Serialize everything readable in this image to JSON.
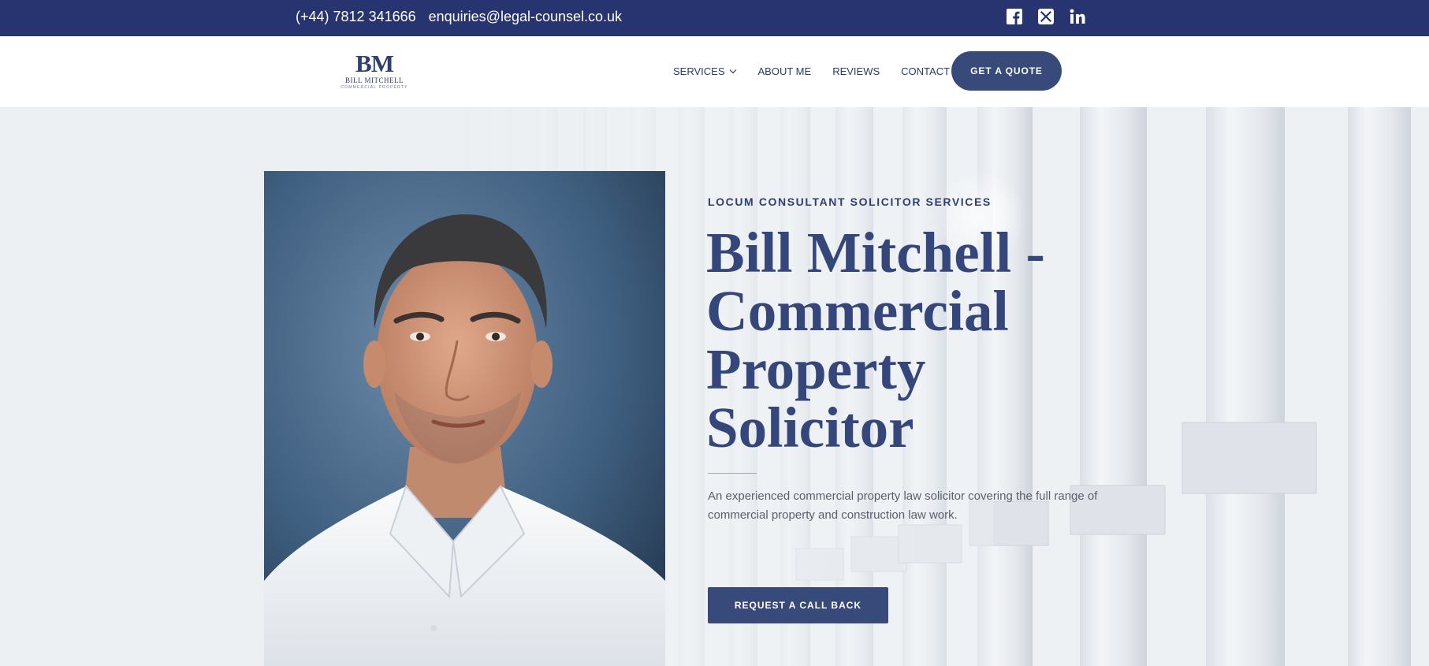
{
  "topbar": {
    "phone": "(+44) 7812 341666",
    "email": "enquiries@legal-counsel.co.uk",
    "socials": [
      "facebook-icon",
      "x-twitter-icon",
      "linkedin-icon"
    ],
    "bg_color": "#283470"
  },
  "logo": {
    "monogram": "BM",
    "name": "BILL MITCHELL",
    "tagline": "COMMERCIAL PROPERTY"
  },
  "nav": {
    "items": [
      {
        "label": "SERVICES",
        "has_dropdown": true
      },
      {
        "label": "ABOUT ME"
      },
      {
        "label": "REVIEWS"
      },
      {
        "label": "CONTACT"
      }
    ],
    "cta_label": "GET A QUOTE"
  },
  "hero": {
    "eyebrow": "LOCUM CONSULTANT SOLICITOR SERVICES",
    "title": "Bill Mitchell - Commercial Property Solicitor",
    "description": "An experienced commercial property law solicitor covering the full range of commercial property and construction law work.",
    "cta_label": "REQUEST A CALL BACK"
  },
  "colors": {
    "brand_navy": "#283470",
    "accent_blue": "#384a79",
    "hero_bg": "#edf0f2"
  }
}
